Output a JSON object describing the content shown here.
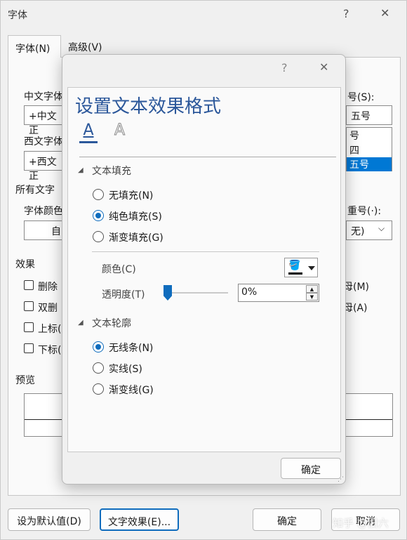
{
  "outer_dialog": {
    "title": "字体",
    "help": "?",
    "close": "✕",
    "tabs": [
      "字体(N)",
      "高级(V)"
    ],
    "labels": {
      "chinese_font": "中文字体",
      "chinese_font_value": "+中文正",
      "western_font": "西文字体",
      "western_font_value": "+西文正",
      "size_label": "号(S):",
      "size_value": "五号",
      "size_list": [
        "号",
        "四",
        "五号"
      ],
      "all_text": "所有文字",
      "font_color": "字体颜色",
      "font_color_value": "自",
      "emphasis_label": "重号(·):",
      "emphasis_value": "无)",
      "effects": "效果",
      "preview": "预览"
    },
    "effects_left": [
      "删除",
      "双删",
      "上标(",
      "下标("
    ],
    "effects_right": [
      "母(M)",
      "母(A)"
    ],
    "buttons": {
      "set_default": "设为默认值(D)",
      "text_effects": "文字效果(E)...",
      "ok": "确定",
      "cancel": "取消"
    },
    "watermark": "知乎 @旧六"
  },
  "modal": {
    "help": "?",
    "close": "✕",
    "title": "设置文本效果格式",
    "tab_icons": [
      "text-fill-icon",
      "text-outline-icon"
    ],
    "section_fill": "文本填充",
    "fill_options": [
      {
        "label": "无填充(N)",
        "selected": false
      },
      {
        "label": "纯色填充(S)",
        "selected": true
      },
      {
        "label": "渐变填充(G)",
        "selected": false
      }
    ],
    "color_label": "颜色(C)",
    "transparency_label": "透明度(T)",
    "transparency_value": "0%",
    "transparency_level": 0,
    "section_outline": "文本轮廓",
    "outline_options": [
      {
        "label": "无线条(N)",
        "selected": true
      },
      {
        "label": "实线(S)",
        "selected": false
      },
      {
        "label": "渐变线(G)",
        "selected": false
      }
    ],
    "ok": "确定",
    "accent": "#2b579a",
    "radio_color": "#0f6cbd"
  }
}
